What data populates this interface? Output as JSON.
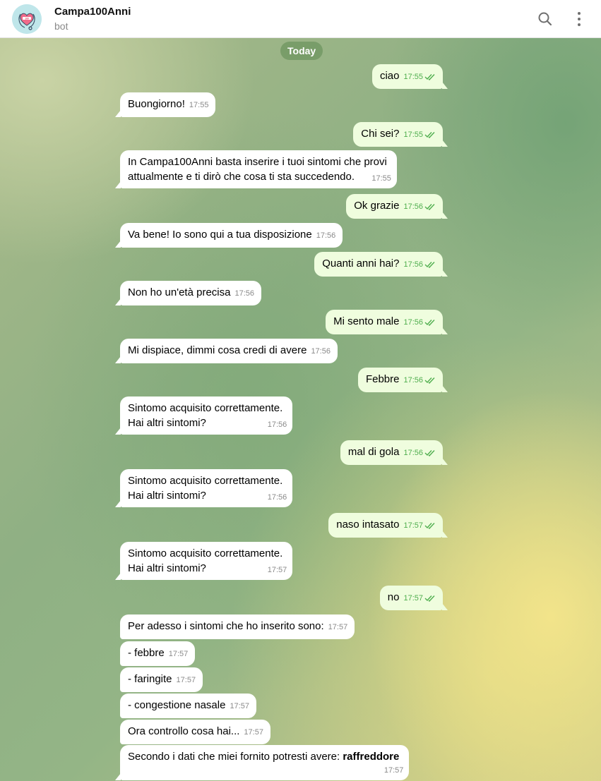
{
  "header": {
    "title": "Campa100Anni",
    "subtitle": "bot",
    "icons": {
      "search": "search-icon",
      "more": "more-vert-icon",
      "avatar": "heart-stethoscope-logo"
    }
  },
  "chat": {
    "date_label": "Today",
    "messages": [
      {
        "dir": "out",
        "text": "ciao",
        "time": "17:55"
      },
      {
        "dir": "in",
        "text": "Buongiorno!",
        "time": "17:55"
      },
      {
        "dir": "out",
        "text": "Chi sei?",
        "time": "17:55"
      },
      {
        "dir": "in",
        "lines": [
          "In Campa100Anni basta inserire i tuoi sintomi che provi",
          "attualmente e ti dirò che cosa ti sta succedendo."
        ],
        "time": "17:55"
      },
      {
        "dir": "out",
        "text": "Ok grazie",
        "time": "17:56"
      },
      {
        "dir": "in",
        "text": "Va bene! Io sono qui a tua disposizione",
        "time": "17:56"
      },
      {
        "dir": "out",
        "text": "Quanti anni hai?",
        "time": "17:56"
      },
      {
        "dir": "in",
        "text": "Non ho un'età precisa",
        "time": "17:56"
      },
      {
        "dir": "out",
        "text": "Mi sento male",
        "time": "17:56"
      },
      {
        "dir": "in",
        "text": "Mi dispiace, dimmi cosa credi di avere",
        "time": "17:56"
      },
      {
        "dir": "out",
        "text": "Febbre",
        "time": "17:56"
      },
      {
        "dir": "in",
        "lines": [
          "Sintomo acquisito correttamente.",
          "Hai altri sintomi?"
        ],
        "time": "17:56"
      },
      {
        "dir": "out",
        "text": "mal di gola",
        "time": "17:56"
      },
      {
        "dir": "in",
        "lines": [
          "Sintomo acquisito correttamente.",
          "Hai altri sintomi?"
        ],
        "time": "17:56"
      },
      {
        "dir": "out",
        "text": "naso intasato",
        "time": "17:57"
      },
      {
        "dir": "in",
        "lines": [
          "Sintomo acquisito correttamente.",
          "Hai altri sintomi?"
        ],
        "time": "17:57"
      },
      {
        "dir": "out",
        "text": "no",
        "time": "17:57"
      },
      {
        "dir": "in",
        "text": "Per adesso i sintomi che ho inserito sono:",
        "time": "17:57"
      },
      {
        "dir": "in",
        "text": "- febbre",
        "time": "17:57"
      },
      {
        "dir": "in",
        "text": "- faringite",
        "time": "17:57"
      },
      {
        "dir": "in",
        "text": "- congestione nasale",
        "time": "17:57"
      },
      {
        "dir": "in",
        "text": "Ora controllo cosa hai...",
        "time": "17:57"
      },
      {
        "dir": "in",
        "text": "Secondo i dati che miei fornito potresti avere:",
        "bold": "raffreddore",
        "time": "17:57"
      }
    ]
  },
  "colors": {
    "incoming_bubble": "#ffffff",
    "outgoing_bubble": "#effdde",
    "read_check": "#4fae4e"
  }
}
